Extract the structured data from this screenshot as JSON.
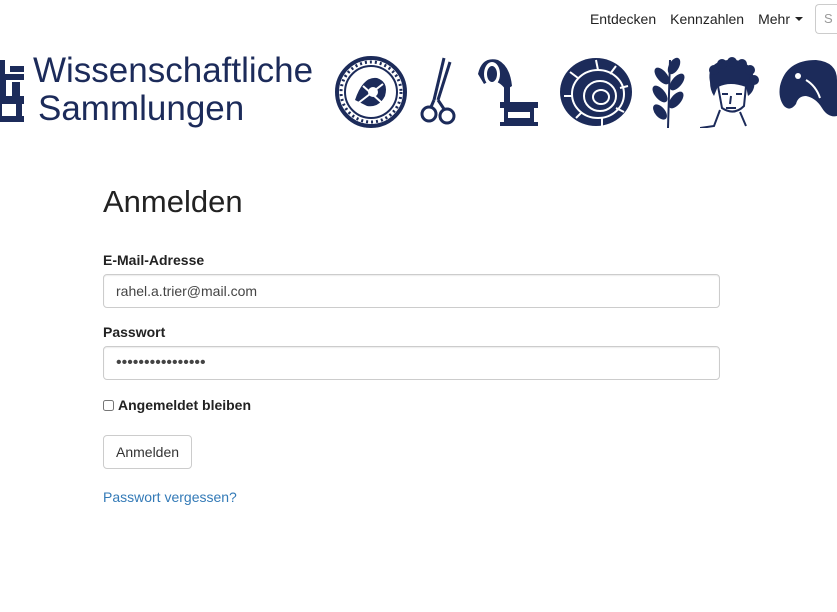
{
  "nav": {
    "items": [
      "Entdecken",
      "Kennzahlen"
    ],
    "more_label": "Mehr",
    "search_placeholder": "S"
  },
  "logo": {
    "line1": "Wissenschaftliche",
    "line2": "Sammlungen",
    "color": "#1c2b5a"
  },
  "banner_icons": [
    "seal-icon",
    "scissors-icon",
    "gramophone-icon",
    "ammonite-icon",
    "leaf-icon",
    "statue-head-icon",
    "horse-head-icon"
  ],
  "login": {
    "title": "Anmelden",
    "email_label": "E-Mail-Adresse",
    "email_value": "rahel.a.trier@mail.com",
    "password_label": "Passwort",
    "password_value": "••••••••••••••••",
    "remember_label": "Angemeldet bleiben",
    "submit_label": "Anmelden",
    "forgot_label": "Passwort vergessen?"
  },
  "colors": {
    "link": "#337ab7",
    "brand": "#1c2b5a"
  }
}
